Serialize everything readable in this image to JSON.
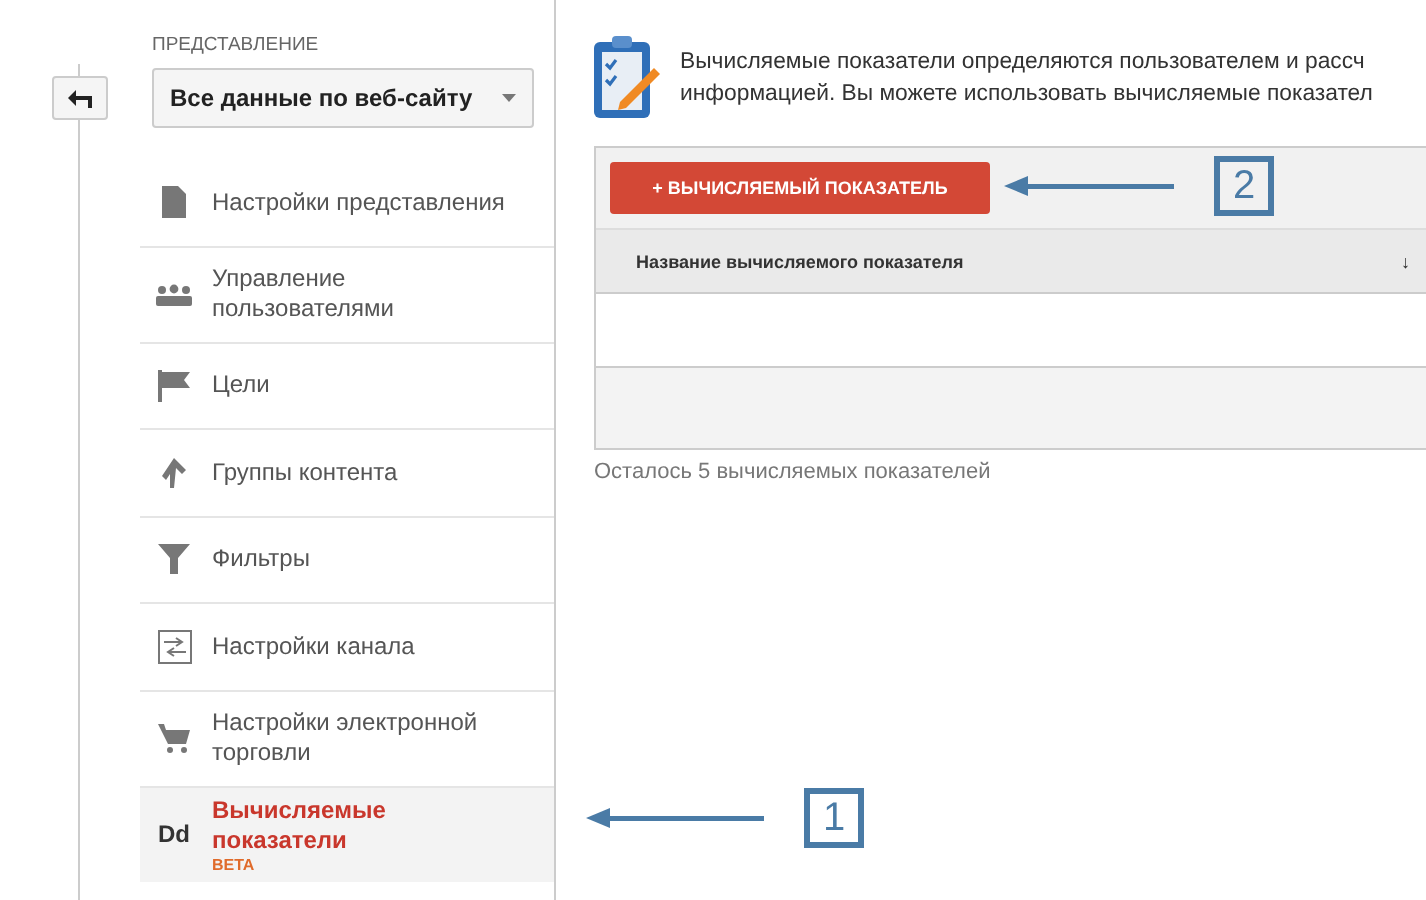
{
  "sidebar": {
    "section_label": "ПРЕДСТАВЛЕНИЕ",
    "view_select": {
      "value": "Все данные по веб-сайту"
    },
    "items": [
      {
        "label": "Настройки представления",
        "selected": false
      },
      {
        "label": "Управление пользователями",
        "selected": false
      },
      {
        "label": "Цели",
        "selected": false
      },
      {
        "label": "Группы контента",
        "selected": false
      },
      {
        "label": "Фильтры",
        "selected": false
      },
      {
        "label": "Настройки канала",
        "selected": false
      },
      {
        "label": "Настройки электронной торговли",
        "selected": false
      },
      {
        "label": "Вычисляемые показатели",
        "badge": "BETA",
        "icon_text": "Dd",
        "selected": true
      }
    ]
  },
  "main": {
    "intro_lines": [
      "Вычисляемые показатели определяются пользователем и рассч",
      "информацией. Вы можете использовать вычисляемые показател"
    ],
    "add_button": "+ ВЫЧИСЛЯЕМЫЙ ПОКАЗАТЕЛЬ",
    "table": {
      "columns": [
        {
          "label": "Название вычисляемого показателя",
          "sort": "↓"
        }
      ]
    },
    "remaining": "Осталось 5 вычисляемых показателей"
  },
  "annotations": [
    {
      "number": "2"
    },
    {
      "number": "1"
    }
  ]
}
